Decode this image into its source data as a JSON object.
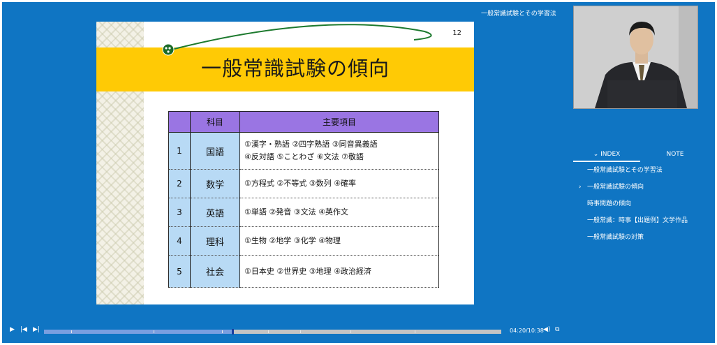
{
  "player": {
    "title": "一般常識試験とその学習法",
    "time": "04:20/10:38",
    "progress": 0.412,
    "chapter_marks": [
      0.06,
      0.24,
      0.39,
      0.49,
      0.56,
      0.67,
      0.81
    ]
  },
  "slide": {
    "page": "12",
    "title": "一般常識試験の傾向",
    "headers": [
      "",
      "科目",
      "主要項目"
    ],
    "rows": [
      {
        "num": "1",
        "subject": "国語",
        "items": [
          "①漢字・熟語 ②四字熟語 ③同音異義語",
          "④反対語 ⑤ことわざ ⑥文法 ⑦敬語"
        ]
      },
      {
        "num": "2",
        "subject": "数学",
        "items": [
          "①方程式 ②不等式 ③数列 ④確率"
        ]
      },
      {
        "num": "3",
        "subject": "英語",
        "items": [
          "①単語 ②発音 ③文法 ④英作文"
        ]
      },
      {
        "num": "4",
        "subject": "理科",
        "items": [
          "①生物 ②地学 ③化学 ④物理"
        ]
      },
      {
        "num": "5",
        "subject": "社会",
        "items": [
          "①日本史 ②世界史 ③地理 ④政治経済"
        ]
      }
    ]
  },
  "tabs": {
    "index": "INDEX",
    "note": "NOTE"
  },
  "index": [
    {
      "label": "一般常識試験とその学習法",
      "current": false
    },
    {
      "label": "一般常識試験の傾向",
      "current": true
    },
    {
      "label": "時事問題の傾向",
      "current": false
    },
    {
      "label": "一般常識：時事【出題例】文学作品",
      "current": false
    },
    {
      "label": "一般常識試験の対策",
      "current": false
    }
  ],
  "colors": {
    "background": "#0f75c3",
    "slide_band": "#ffca05",
    "header": "#9a75e3",
    "subject_cell": "#b8daf5"
  },
  "icons": [
    "play-icon",
    "skip-back-icon",
    "skip-forward-icon",
    "volume-icon",
    "fullscreen-icon",
    "chevron-down-icon",
    "chevron-right-icon"
  ]
}
